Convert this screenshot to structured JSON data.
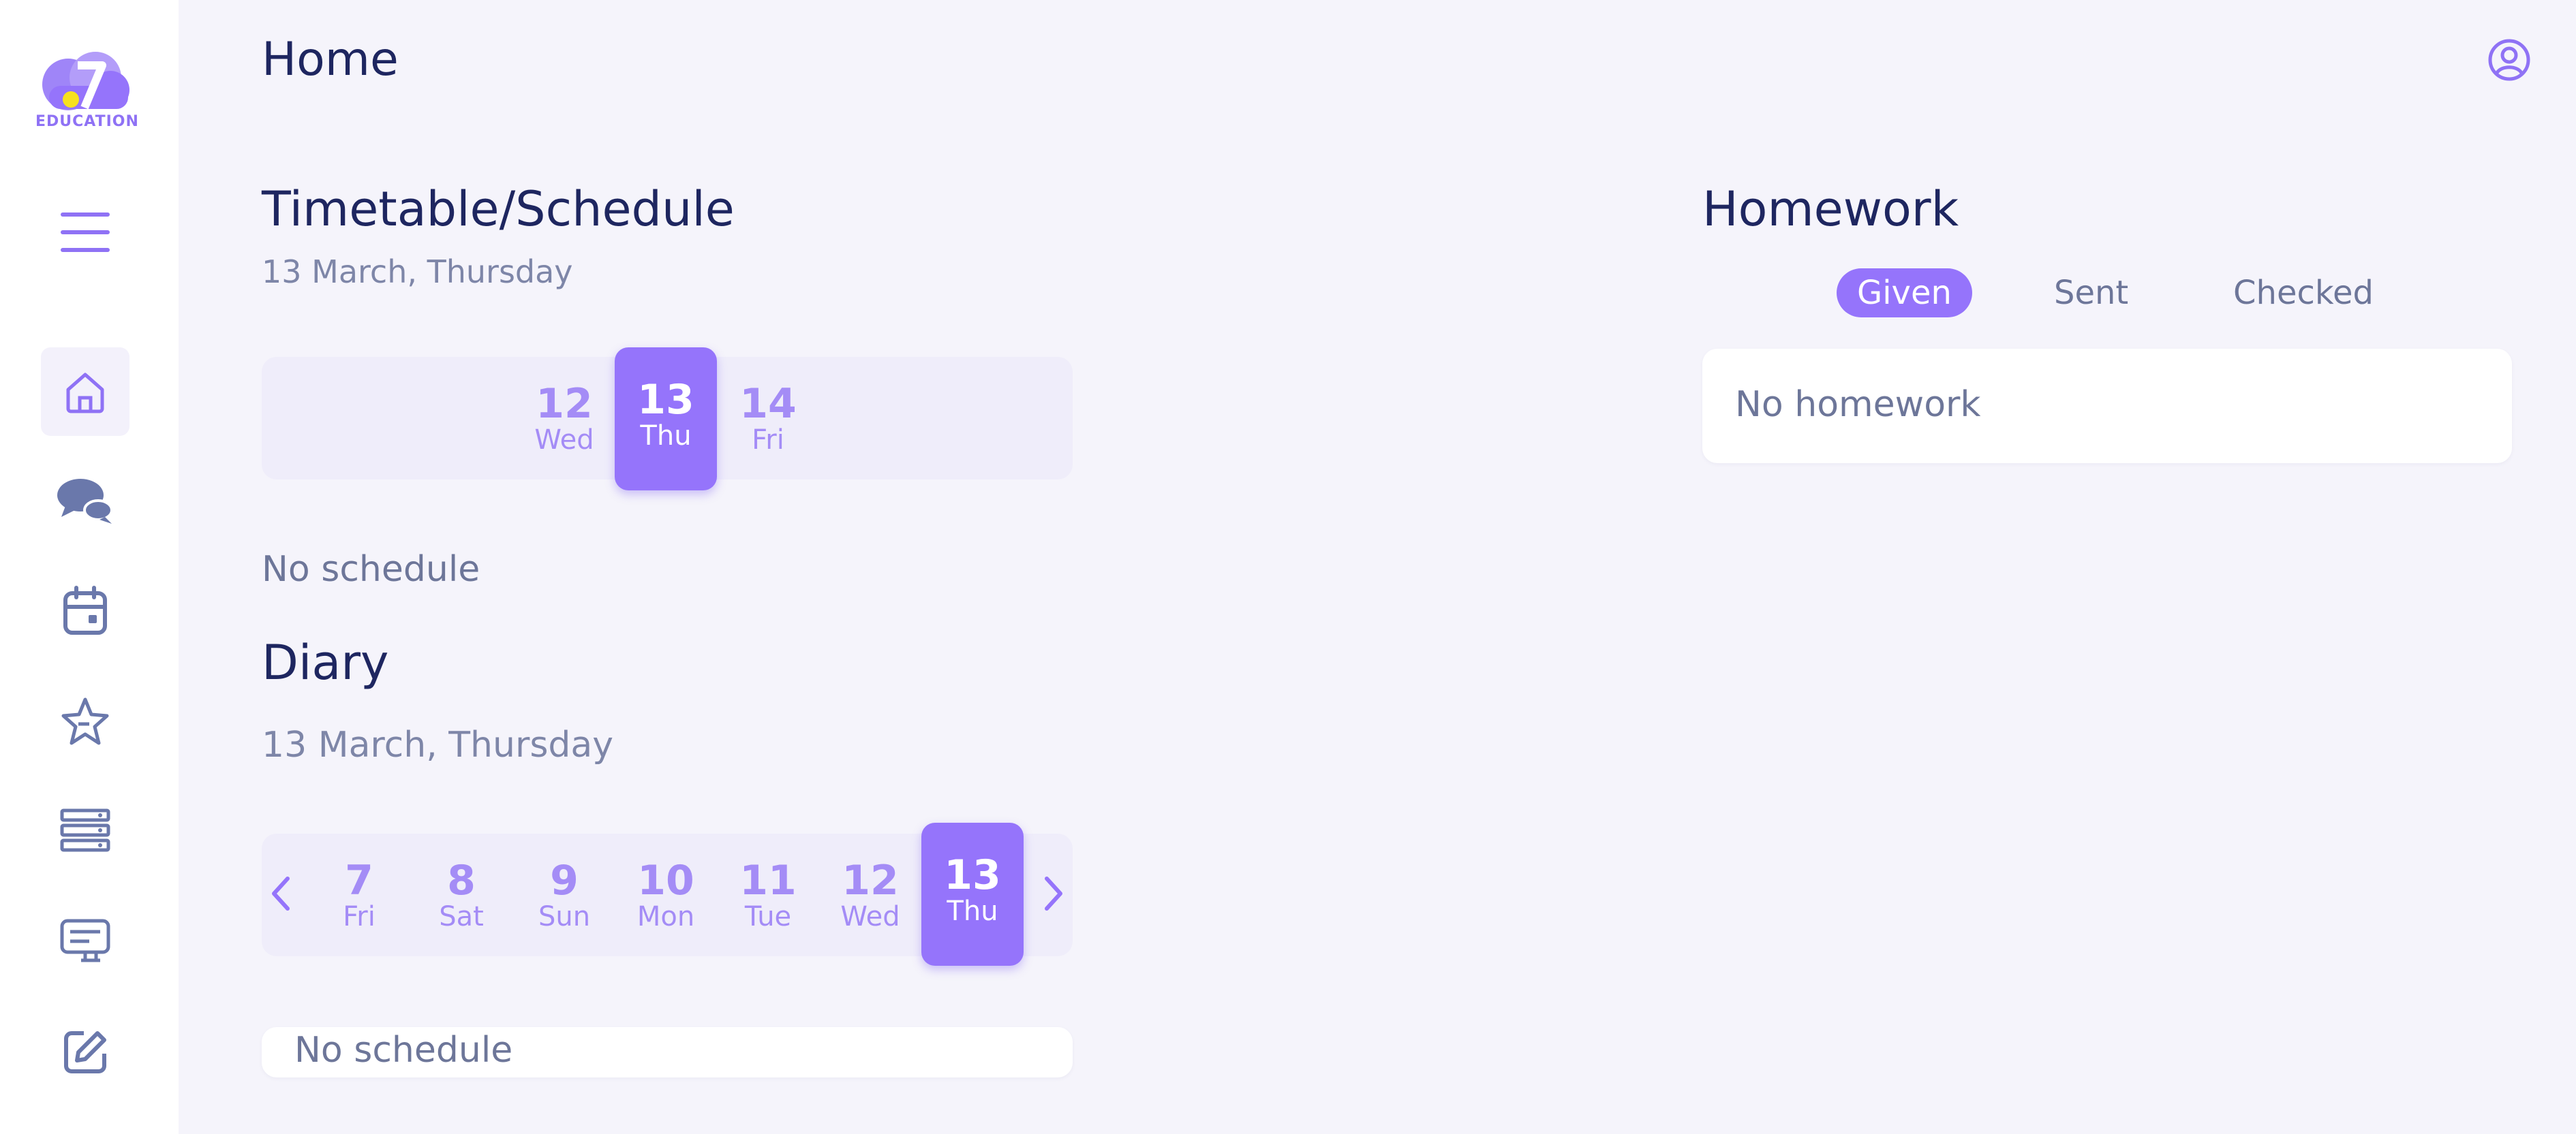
{
  "app": {
    "logo_text": "EDUCATION"
  },
  "header": {
    "title": "Home"
  },
  "sidebar": {
    "items": [
      {
        "name": "home",
        "icon": "home-icon",
        "active": true
      },
      {
        "name": "chat",
        "icon": "chat-icon"
      },
      {
        "name": "calendar",
        "icon": "calendar-icon"
      },
      {
        "name": "achievements",
        "icon": "star-icon"
      },
      {
        "name": "list",
        "icon": "list-icon"
      },
      {
        "name": "courses",
        "icon": "course-icon"
      },
      {
        "name": "edit",
        "icon": "edit-icon"
      }
    ],
    "menu_icon": "hamburger-icon"
  },
  "timetable": {
    "title": "Timetable/Schedule",
    "date": "13 March, Thursday",
    "days": [
      {
        "num": "12",
        "wd": "Wed"
      },
      {
        "num": "13",
        "wd": "Thu",
        "selected": true
      },
      {
        "num": "14",
        "wd": "Fri"
      }
    ],
    "empty": "No schedule"
  },
  "diary": {
    "title": "Diary",
    "date": "13 March, Thursday",
    "days": [
      {
        "num": "7",
        "wd": "Fri"
      },
      {
        "num": "8",
        "wd": "Sat"
      },
      {
        "num": "9",
        "wd": "Sun"
      },
      {
        "num": "10",
        "wd": "Mon"
      },
      {
        "num": "11",
        "wd": "Tue"
      },
      {
        "num": "12",
        "wd": "Wed"
      },
      {
        "num": "13",
        "wd": "Thu",
        "selected": true
      }
    ],
    "empty": "No schedule"
  },
  "homework": {
    "title": "Homework",
    "tabs": [
      {
        "label": "Given",
        "active": true
      },
      {
        "label": "Sent"
      },
      {
        "label": "Checked"
      }
    ],
    "empty": "No homework"
  },
  "colors": {
    "accent": "#9574fb",
    "text_dark": "#1e2660",
    "text_muted": "#6d7699",
    "bg": "#f5f4fb"
  }
}
